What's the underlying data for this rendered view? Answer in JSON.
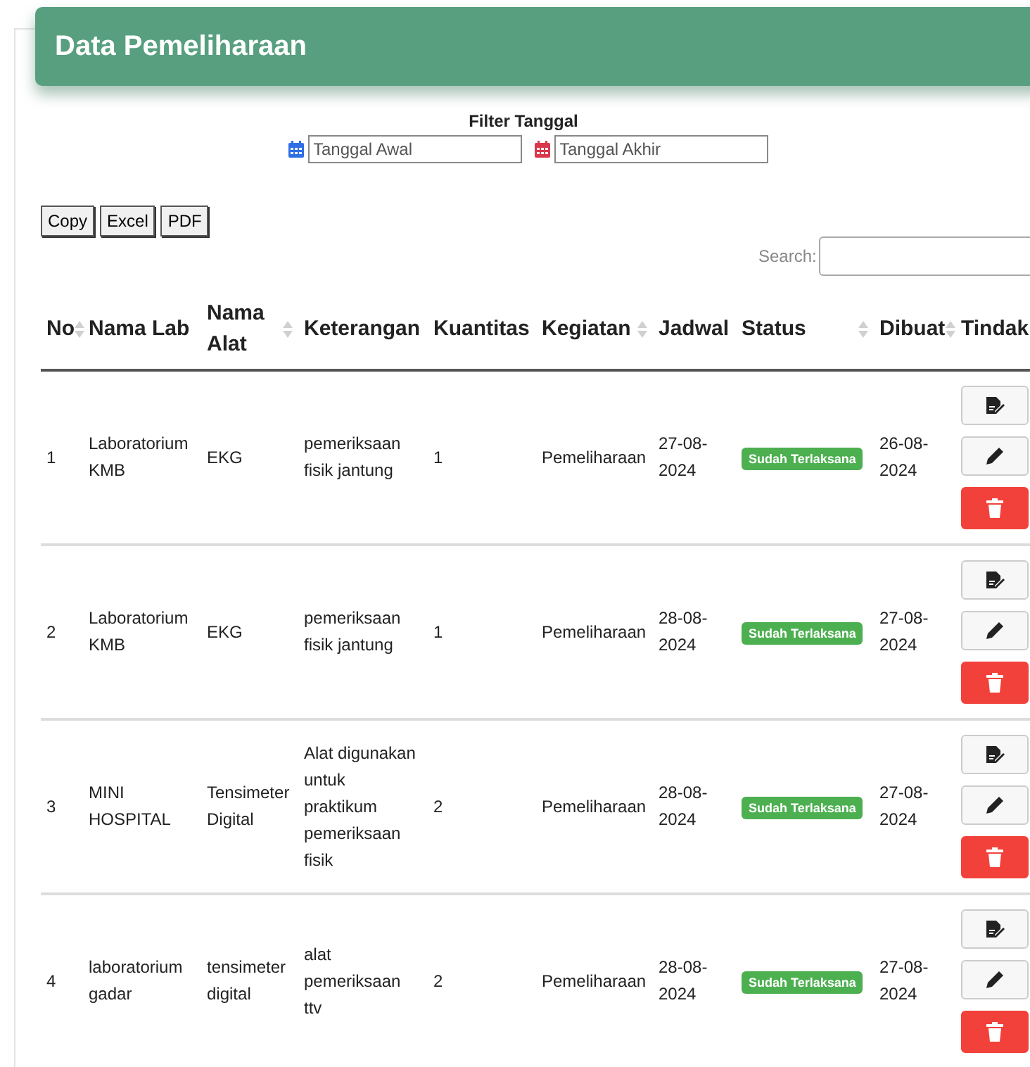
{
  "title": "Data Pemeliharaan",
  "filter": {
    "label": "Filter Tanggal",
    "start": {
      "placeholder": "Tanggal Awal"
    },
    "end": {
      "placeholder": "Tanggal Akhir"
    }
  },
  "export_buttons": [
    "Copy",
    "Excel",
    "PDF"
  ],
  "search": {
    "label": "Search:"
  },
  "table": {
    "columns": [
      "No",
      "Nama Lab",
      "Nama Alat",
      "Keterangan",
      "Kuantitas",
      "Kegiatan",
      "Jadwal",
      "Status",
      "Dibuat",
      "Tindak"
    ],
    "rows": [
      {
        "no": "1",
        "lab": "Laboratorium KMB",
        "alat": "EKG",
        "keterangan": "pemeriksaan fisik jantung",
        "kuantitas": "1",
        "kegiatan": "Pemeliharaan",
        "jadwal": "27-08-2024",
        "status": "Sudah Terlaksana",
        "dibuat": "26-08-2024"
      },
      {
        "no": "2",
        "lab": "Laboratorium KMB",
        "alat": "EKG",
        "keterangan": "pemeriksaan fisik jantung",
        "kuantitas": "1",
        "kegiatan": "Pemeliharaan",
        "jadwal": "28-08-2024",
        "status": "Sudah Terlaksana",
        "dibuat": "27-08-2024"
      },
      {
        "no": "3",
        "lab": "MINI HOSPITAL",
        "alat": "Tensimeter Digital",
        "keterangan": "Alat digunakan untuk praktikum pemeriksaan fisik",
        "kuantitas": "2",
        "kegiatan": "Pemeliharaan",
        "jadwal": "28-08-2024",
        "status": "Sudah Terlaksana",
        "dibuat": "27-08-2024"
      },
      {
        "no": "4",
        "lab": "laboratorium gadar",
        "alat": "tensimeter digital",
        "keterangan": "alat pemeriksaan ttv",
        "kuantitas": "2",
        "kegiatan": "Pemeliharaan",
        "jadwal": "28-08-2024",
        "status": "Sudah Terlaksana",
        "dibuat": "27-08-2024"
      }
    ]
  }
}
